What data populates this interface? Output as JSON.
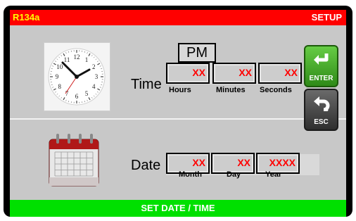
{
  "header": {
    "model": "R134a",
    "mode": "SETUP"
  },
  "footer": {
    "title": "SET DATE / TIME"
  },
  "time": {
    "label": "Time",
    "ampm": "PM",
    "fields": [
      {
        "value": "XX",
        "caption": "Hours"
      },
      {
        "value": "XX",
        "caption": "Minutes"
      },
      {
        "value": "XX",
        "caption": "Seconds"
      }
    ]
  },
  "date": {
    "label": "Date",
    "fields": [
      {
        "value": "XX",
        "caption": "Month"
      },
      {
        "value": "XX",
        "caption": "Day"
      },
      {
        "value": "XXXX",
        "caption": "Year"
      }
    ]
  },
  "buttons": {
    "enter": "ENTER",
    "esc": "ESC"
  },
  "clock": {
    "numerals": [
      "12",
      "1",
      "2",
      "3",
      "4",
      "5",
      "6",
      "7",
      "8",
      "9",
      "10",
      "11"
    ]
  },
  "colors": {
    "header_bg": "#ff0000",
    "footer_bg": "#00e000",
    "value_red": "#ff0000",
    "model_yellow": "#ffff00"
  }
}
